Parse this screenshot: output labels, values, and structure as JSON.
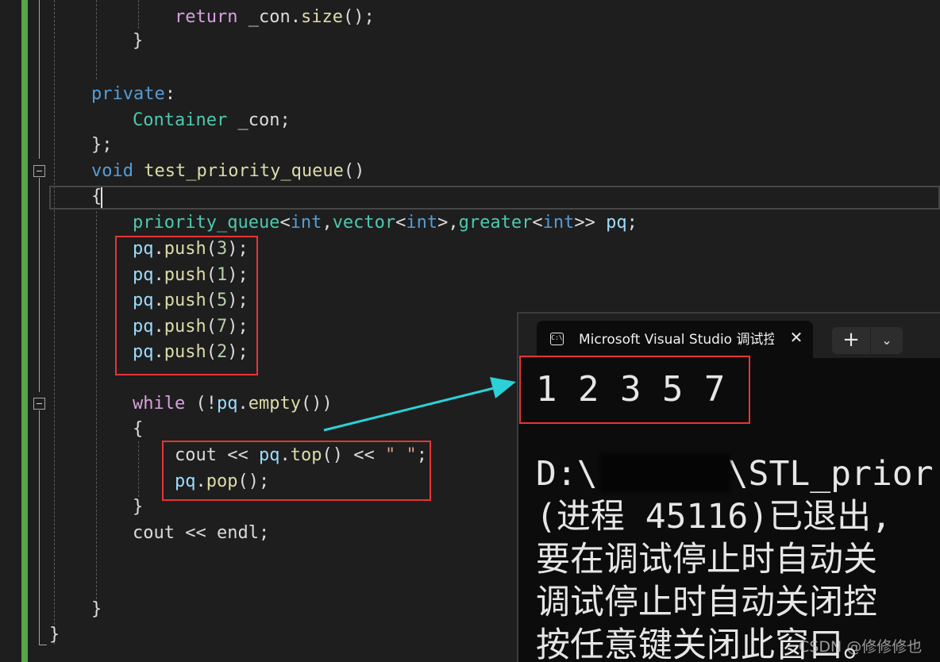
{
  "editor": {
    "lines": {
      "l1": {
        "kw": "return",
        "rest1": " _con.",
        "fn": "size",
        "rest2": "();"
      },
      "l2": {
        "text": "}"
      },
      "l3": {
        "kw": "private",
        "rest": ":"
      },
      "l4": {
        "ty": "Container",
        "rest": " _con;"
      },
      "l5": {
        "text": "};"
      },
      "l6": {
        "kw": "void",
        "fn": "test_priority_queue",
        "rest": "()"
      },
      "l7": {
        "text": "{"
      },
      "l8": {
        "ty1": "priority_queue",
        "p1": "<",
        "kw1": "int",
        "p2": ",",
        "ty2": "vector",
        "p3": "<",
        "kw2": "int",
        "p4": ">,",
        "ty3": "greater",
        "p5": "<",
        "kw3": "int",
        "p6": ">> ",
        "var": "pq",
        "p7": ";"
      },
      "push1": {
        "var": "pq",
        "dot": ".",
        "fn": "push",
        "open": "(",
        "num": "3",
        "close": ");"
      },
      "push2": {
        "var": "pq",
        "dot": ".",
        "fn": "push",
        "open": "(",
        "num": "1",
        "close": ");"
      },
      "push3": {
        "var": "pq",
        "dot": ".",
        "fn": "push",
        "open": "(",
        "num": "5",
        "close": ");"
      },
      "push4": {
        "var": "pq",
        "dot": ".",
        "fn": "push",
        "open": "(",
        "num": "7",
        "close": ");"
      },
      "push5": {
        "var": "pq",
        "dot": ".",
        "fn": "push",
        "open": "(",
        "num": "2",
        "close": ");"
      },
      "while": {
        "kw": "while",
        "p1": " (!",
        "var": "pq",
        "dot": ".",
        "fn": "empty",
        "p2": "())"
      },
      "wopen": {
        "text": "{"
      },
      "cout1": {
        "t1": "cout ",
        "op1": "<<",
        "sp": " ",
        "var": "pq",
        "dot": ".",
        "fn": "top",
        "p1": "() ",
        "op2": "<<",
        "sp2": " ",
        "str": "\" \"",
        "p2": ";"
      },
      "pop": {
        "var": "pq",
        "dot": ".",
        "fn": "pop",
        "rest": "();"
      },
      "wclose": {
        "text": "}"
      },
      "cout2": {
        "t1": "cout ",
        "op": "<<",
        "t2": " endl;"
      },
      "fclose": {
        "text": "}"
      },
      "cclose": {
        "text": "}"
      }
    }
  },
  "terminal": {
    "tab_title": "Microsoft Visual Studio 调试控制台",
    "tab_icon_text": "C:\\",
    "close_glyph": "✕",
    "newtab_glyph": "+",
    "dropdown_glyph": "⌄",
    "output": "1 2 3 5 7",
    "path_prefix": "D:\\",
    "path_suffix": "\\STL_prior",
    "line2": "(进程 45116)已退出,",
    "line3": "要在调试停止时自动关",
    "line4": "调试停止时自动关闭控",
    "line5": "按任意键关闭此窗口。"
  },
  "watermark": "CSDN @修修修也",
  "colors": {
    "background": "#1e1e1e",
    "change_bar": "#57a64a",
    "highlight_box": "#e63535",
    "arrow": "#2bd1d8"
  }
}
